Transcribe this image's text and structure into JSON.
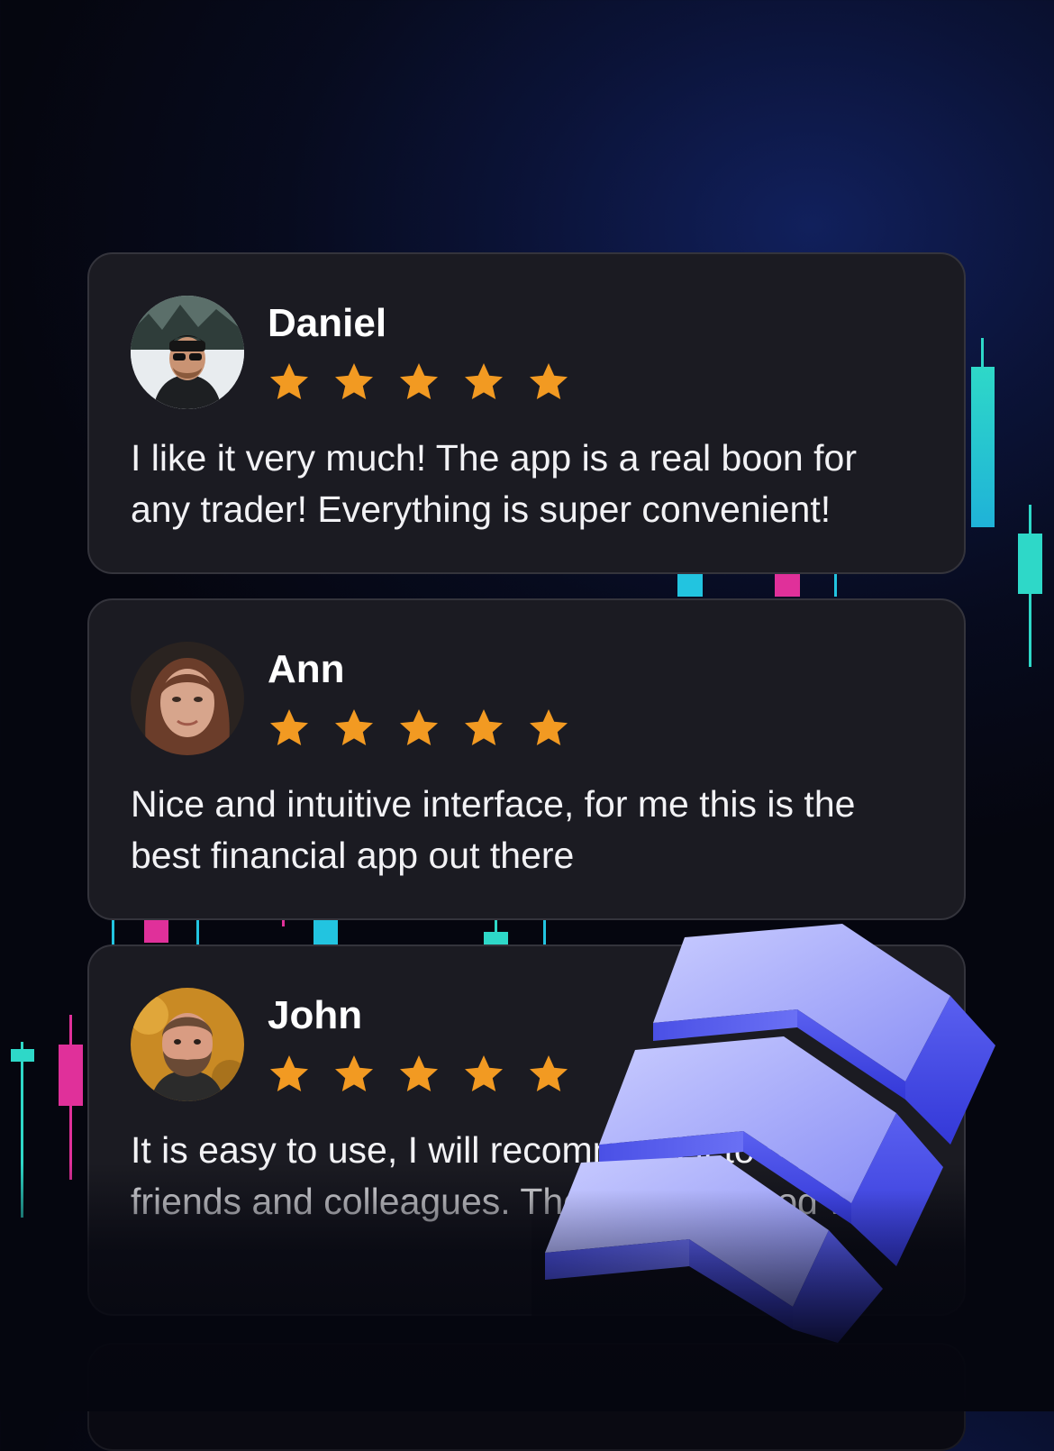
{
  "reviews": [
    {
      "name": "Daniel",
      "rating": 5,
      "text": "I like it very much! The app is a real boon for any trader! Everything is super convenient!",
      "avatar": "man-beanie-sunglasses-avatar"
    },
    {
      "name": "Ann",
      "rating": 5,
      "text": "Nice and intuitive interface, for me this is the best financial app out there",
      "avatar": "woman-avatar"
    },
    {
      "name": "John",
      "rating": 5,
      "text": "It is easy to use, I will recommend it to my friends and colleagues. The app has good work",
      "avatar": "bearded-man-avatar"
    }
  ],
  "colors": {
    "star": "#f29a22",
    "card_bg": "#1b1b22",
    "candle_up": "#2ed8c8",
    "candle_down": "#e0309a",
    "logo": "#6a6ff2"
  },
  "icons": {
    "star": "star-icon",
    "logo": "3d-chevron-logo"
  }
}
